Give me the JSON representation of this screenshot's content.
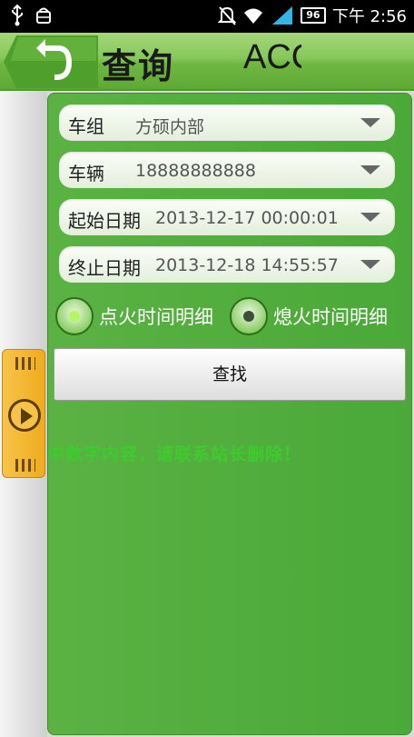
{
  "status_bar": {
    "time": "下午 2:56",
    "battery": "96"
  },
  "header": {
    "title": "查询",
    "subtitle": "ACC"
  },
  "form": {
    "vehicle_group": {
      "label": "车组",
      "value": "方硕内部"
    },
    "vehicle": {
      "label": "车辆",
      "value": "18888888888"
    },
    "start_date": {
      "label": "起始日期",
      "value": "2013-12-17 00:00:01"
    },
    "end_date": {
      "label": "终止日期",
      "value": "2013-12-18 14:55:57"
    },
    "radio_ignition_on": {
      "label": "点火时间明细",
      "selected": true
    },
    "radio_ignition_off": {
      "label": "熄火时间明细",
      "selected": false
    },
    "search_label": "查找"
  },
  "marquee": "图片中数字内容，请联系站长删除！",
  "colors": {
    "accent_green": "#4aa938",
    "header_green": "#86c85a",
    "handle_orange": "#f0ab1d",
    "marquee_green": "#3ecb2e"
  },
  "icons": {
    "back": "back-arrow-icon",
    "dropdown": "chevron-down-icon",
    "play": "play-icon"
  }
}
